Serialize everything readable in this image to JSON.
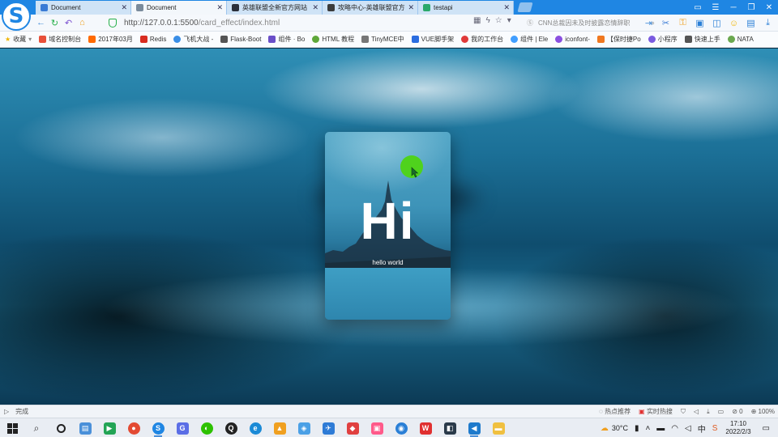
{
  "browser": {
    "tabs": [
      {
        "title": "Document",
        "active": false,
        "favicon_color": "#3a7bd5"
      },
      {
        "title": "Document",
        "active": true,
        "favicon_color": "#7a8b9c"
      },
      {
        "title": "英雄联盟全新官方网站",
        "active": false,
        "favicon_color": "#2a2f3a"
      },
      {
        "title": "攻略中心-英雄联盟官方",
        "active": false,
        "favicon_color": "#3b3b3b"
      },
      {
        "title": "testapi",
        "active": false,
        "favicon_color": "#2aa86a"
      }
    ],
    "close_glyph": "✕",
    "address": {
      "host": "http://127.0.0.1:5500",
      "path": "/card_effect/index.html"
    },
    "search": {
      "placeholder": "CNN总裁因未及时披露恋情辞职"
    },
    "window_controls": [
      "▭",
      "☰",
      "─",
      "❐",
      "✕"
    ]
  },
  "bookmarks": [
    {
      "label": "收藏",
      "color": "#f0b400"
    },
    {
      "label": "域名控制台",
      "color": "#e8503a"
    },
    {
      "label": "2017年03月",
      "color": "#ff6a00"
    },
    {
      "label": "Redis",
      "color": "#d82c20"
    },
    {
      "label": "飞机大战 -",
      "color": "#3a8ee6"
    },
    {
      "label": "Flask-Boot",
      "color": "#555555"
    },
    {
      "label": "组件 · Bo",
      "color": "#6a4fc8"
    },
    {
      "label": "HTML 教程",
      "color": "#5fa83a"
    },
    {
      "label": "TinyMCE中",
      "color": "#777777"
    },
    {
      "label": "VUE脚手架",
      "color": "#2b6de0"
    },
    {
      "label": "我的工作台",
      "color": "#e03a3a"
    },
    {
      "label": "组件 | Ele",
      "color": "#409eff"
    },
    {
      "label": "iconfont-",
      "color": "#8a4fe0"
    },
    {
      "label": "【保时捷Po",
      "color": "#f07820"
    },
    {
      "label": "小程序",
      "color": "#7a5be0"
    },
    {
      "label": "快速上手",
      "color": "#555555"
    },
    {
      "label": "NATA",
      "color": "#6aa84f"
    }
  ],
  "card": {
    "headline": "Hi",
    "subtitle": "hello world"
  },
  "status": {
    "done_text": "完成",
    "hot_news": "热点推荐",
    "live_hot": "实时热搜",
    "zero": "0",
    "zoom": "100%"
  },
  "taskbar": {
    "weather": "30°C",
    "time": "17:10",
    "date": "2022/2/3",
    "apps": [
      {
        "name": "file-explorer",
        "color": "#4a90d9",
        "glyph": "▤"
      },
      {
        "name": "media-player",
        "color": "#23a455",
        "glyph": "▶"
      },
      {
        "name": "chrome",
        "color": "#e34a33",
        "glyph": "●"
      },
      {
        "name": "sogou-browser",
        "color": "#1f86e3",
        "glyph": "S"
      },
      {
        "name": "app-g",
        "color": "#5b6ee6",
        "glyph": "G"
      },
      {
        "name": "wechat",
        "color": "#2dc100",
        "glyph": "◐"
      },
      {
        "name": "qq",
        "color": "#222222",
        "glyph": "Q"
      },
      {
        "name": "edge",
        "color": "#1b8ad6",
        "glyph": "e"
      },
      {
        "name": "app-yellow",
        "color": "#f0a020",
        "glyph": "▲"
      },
      {
        "name": "app-share",
        "color": "#4aa0e6",
        "glyph": "◈"
      },
      {
        "name": "app-plane",
        "color": "#2e7bd6",
        "glyph": "✈"
      },
      {
        "name": "app-red",
        "color": "#e04040",
        "glyph": "◆"
      },
      {
        "name": "app-pink",
        "color": "#ff5a8a",
        "glyph": "▣"
      },
      {
        "name": "app-blue-circle",
        "color": "#2a7fd6",
        "glyph": "◉"
      },
      {
        "name": "wps",
        "color": "#e03030",
        "glyph": "W"
      },
      {
        "name": "app-dark",
        "color": "#2a3a4a",
        "glyph": "◧"
      },
      {
        "name": "vscode",
        "color": "#1e7acc",
        "glyph": "◀"
      },
      {
        "name": "folder",
        "color": "#f0c040",
        "glyph": "▬"
      }
    ]
  }
}
